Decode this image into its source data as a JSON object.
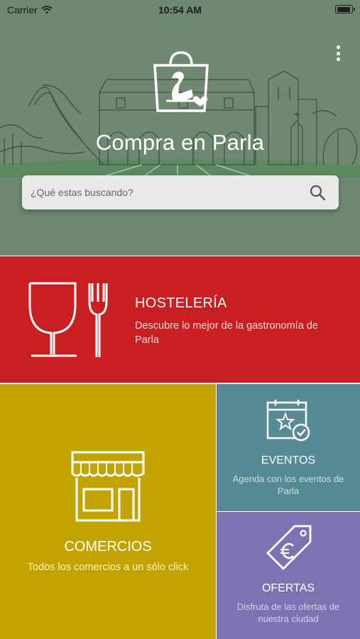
{
  "status_bar": {
    "carrier": "Carrier",
    "time": "10:54 AM"
  },
  "header": {
    "title": "Compra en Parla",
    "menu_icon": "more-vertical-icon",
    "logo_icon": "shopping-bag-swan-logo"
  },
  "search": {
    "placeholder": "¿Qué estas buscando?",
    "icon": "search-icon"
  },
  "tiles": {
    "hosteleria": {
      "title": "HOSTELERÍA",
      "description": "Descubre lo mejor de la gastronomía de Parla",
      "icon": "wine-glass-fork-icon",
      "color": "#c91e22"
    },
    "comercios": {
      "title": "COMERCIOS",
      "description": "Todos los comercios a un sólo click",
      "icon": "storefront-icon",
      "color": "#c3a300"
    },
    "eventos": {
      "title": "EVENTOS",
      "description": "Agenda con los eventos de Parla",
      "icon": "calendar-star-icon",
      "color": "#568a95"
    },
    "ofertas": {
      "title": "OFERTAS",
      "description": "Disfruta de las ofertas de nuestra ciudad",
      "icon": "euro-tag-icon",
      "color": "#7d73b3"
    }
  },
  "colors": {
    "hero_background": "#6e8872",
    "hero_sketch_lines": "#2f3f33",
    "search_background": "#e8eae8"
  }
}
